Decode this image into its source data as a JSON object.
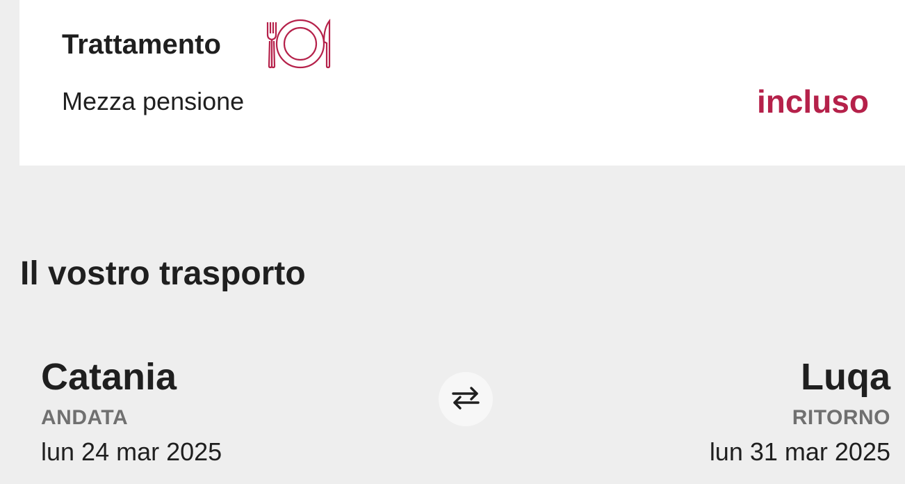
{
  "meal_card": {
    "title": "Trattamento",
    "icon": "plate-cutlery-icon",
    "board_type": "Mezza pensione",
    "status": "incluso",
    "accent_color": "#b5214a"
  },
  "transport": {
    "section_title": "Il vostro trasporto",
    "outbound": {
      "city": "Catania",
      "label": "ANDATA",
      "date": "lun 24 mar 2025"
    },
    "swap_icon": "swap-arrows-icon",
    "return": {
      "city": "Luqa",
      "label": "RITORNO",
      "date": "lun 31 mar 2025"
    }
  }
}
